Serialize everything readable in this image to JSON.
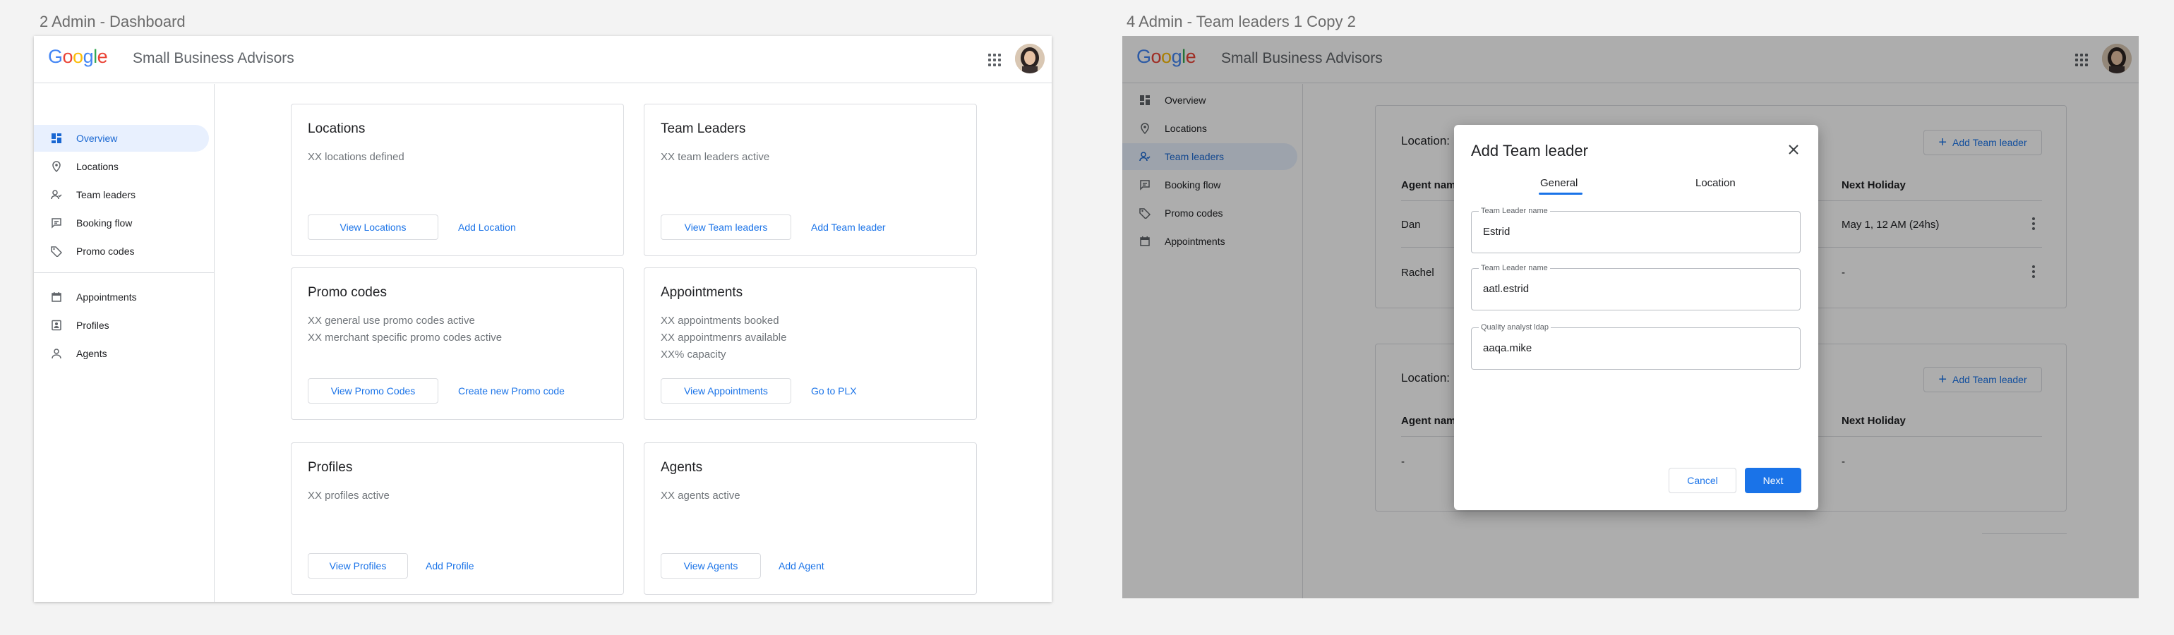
{
  "frames": {
    "left_title": "2 Admin - Dashboard",
    "right_title": "4 Admin - Team leaders 1 Copy 2"
  },
  "brand": {
    "logo_letters": [
      {
        "ch": "G",
        "color": "#4285F4"
      },
      {
        "ch": "o",
        "color": "#EA4335"
      },
      {
        "ch": "o",
        "color": "#FBBC05"
      },
      {
        "ch": "g",
        "color": "#4285F4"
      },
      {
        "ch": "l",
        "color": "#34A853"
      },
      {
        "ch": "e",
        "color": "#EA4335"
      }
    ],
    "app_title": "Small Business Advisors",
    "accent": "#1a73e8"
  },
  "dashboard": {
    "nav_primary": [
      {
        "label": "Overview",
        "icon": "dashboard-icon",
        "active": true
      },
      {
        "label": "Locations",
        "icon": "location-pin-icon"
      },
      {
        "label": "Team leaders",
        "icon": "team-icon"
      },
      {
        "label": "Booking flow",
        "icon": "booking-icon"
      },
      {
        "label": "Promo codes",
        "icon": "tag-icon"
      }
    ],
    "nav_secondary": [
      {
        "label": "Appointments",
        "icon": "calendar-icon"
      },
      {
        "label": "Profiles",
        "icon": "profile-icon"
      },
      {
        "label": "Agents",
        "icon": "person-icon"
      }
    ],
    "cards": [
      {
        "title": "Locations",
        "lines": [
          "XX locations defined"
        ],
        "primary": "View Locations",
        "secondary": "Add Location"
      },
      {
        "title": "Team Leaders",
        "lines": [
          "XX team leaders active"
        ],
        "primary": "View Team leaders",
        "secondary": "Add Team leader"
      },
      {
        "title": "Promo codes",
        "lines": [
          "XX general use promo codes active",
          "XX merchant specific promo codes active"
        ],
        "primary": "View Promo Codes",
        "secondary": "Create new Promo code"
      },
      {
        "title": "Appointments",
        "lines": [
          "XX appointments booked",
          "XX appointmenrs available",
          "XX% capacity"
        ],
        "primary": "View Appointments",
        "secondary": "Go to PLX"
      },
      {
        "title": "Profiles",
        "lines": [
          "XX profiles active"
        ],
        "primary": "View Profiles",
        "secondary": "Add Profile"
      },
      {
        "title": "Agents",
        "lines": [
          "XX agents active"
        ],
        "primary": "View Agents",
        "secondary": "Add Agent"
      }
    ]
  },
  "teamleaders": {
    "nav": [
      {
        "label": "Overview",
        "icon": "dashboard-icon"
      },
      {
        "label": "Locations",
        "icon": "location-pin-icon"
      },
      {
        "label": "Team leaders",
        "icon": "team-icon",
        "active": true
      },
      {
        "label": "Booking flow",
        "icon": "booking-icon"
      },
      {
        "label": "Promo codes",
        "icon": "tag-icon"
      },
      {
        "label": "Appointments",
        "icon": "calendar-icon"
      }
    ],
    "sections": [
      {
        "location_label": "Location:",
        "add_button": "Add Team leader",
        "col_agent": "Agent nam",
        "col_holiday": "Next Holiday",
        "rows": [
          {
            "agent": "Dan",
            "holiday": "May 1, 12 AM (24hs)"
          },
          {
            "agent": "Rachel",
            "holiday": "-"
          }
        ]
      },
      {
        "location_label": "Location:",
        "add_button": "Add Team leader",
        "col_agent": "Agent nam",
        "col_holiday": "Next Holiday",
        "rows": [
          {
            "agent": "-",
            "holiday": "-"
          }
        ]
      }
    ],
    "dialog": {
      "title": "Add Team leader",
      "tabs": [
        {
          "label": "General",
          "active": true
        },
        {
          "label": "Location"
        }
      ],
      "fields": [
        {
          "label": "Team Leader name",
          "value": "Estrid"
        },
        {
          "label": "Team Leader name",
          "value": "aatl.estrid"
        },
        {
          "label": "Quality analyst ldap",
          "value": "aaqa.mike"
        }
      ],
      "cancel": "Cancel",
      "next": "Next"
    }
  }
}
